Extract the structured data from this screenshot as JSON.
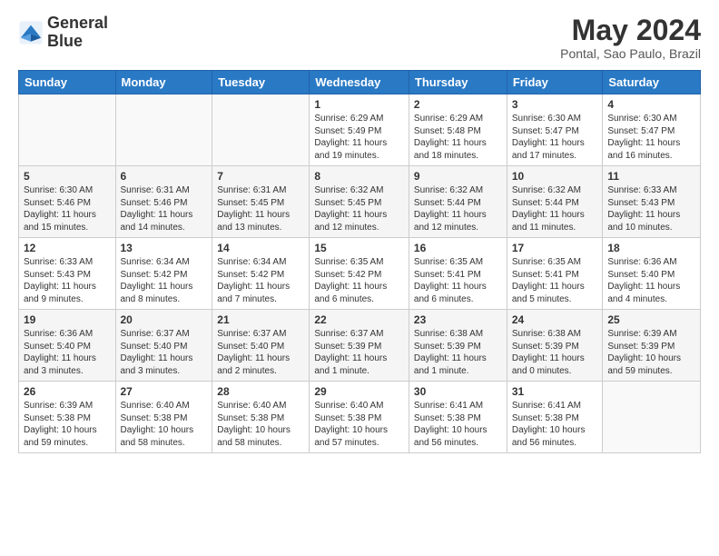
{
  "header": {
    "logo_line1": "General",
    "logo_line2": "Blue",
    "month_title": "May 2024",
    "location": "Pontal, Sao Paulo, Brazil"
  },
  "weekdays": [
    "Sunday",
    "Monday",
    "Tuesday",
    "Wednesday",
    "Thursday",
    "Friday",
    "Saturday"
  ],
  "weeks": [
    [
      {
        "day": "",
        "sunrise": "",
        "sunset": "",
        "daylight": ""
      },
      {
        "day": "",
        "sunrise": "",
        "sunset": "",
        "daylight": ""
      },
      {
        "day": "",
        "sunrise": "",
        "sunset": "",
        "daylight": ""
      },
      {
        "day": "1",
        "sunrise": "Sunrise: 6:29 AM",
        "sunset": "Sunset: 5:49 PM",
        "daylight": "Daylight: 11 hours and 19 minutes."
      },
      {
        "day": "2",
        "sunrise": "Sunrise: 6:29 AM",
        "sunset": "Sunset: 5:48 PM",
        "daylight": "Daylight: 11 hours and 18 minutes."
      },
      {
        "day": "3",
        "sunrise": "Sunrise: 6:30 AM",
        "sunset": "Sunset: 5:47 PM",
        "daylight": "Daylight: 11 hours and 17 minutes."
      },
      {
        "day": "4",
        "sunrise": "Sunrise: 6:30 AM",
        "sunset": "Sunset: 5:47 PM",
        "daylight": "Daylight: 11 hours and 16 minutes."
      }
    ],
    [
      {
        "day": "5",
        "sunrise": "Sunrise: 6:30 AM",
        "sunset": "Sunset: 5:46 PM",
        "daylight": "Daylight: 11 hours and 15 minutes."
      },
      {
        "day": "6",
        "sunrise": "Sunrise: 6:31 AM",
        "sunset": "Sunset: 5:46 PM",
        "daylight": "Daylight: 11 hours and 14 minutes."
      },
      {
        "day": "7",
        "sunrise": "Sunrise: 6:31 AM",
        "sunset": "Sunset: 5:45 PM",
        "daylight": "Daylight: 11 hours and 13 minutes."
      },
      {
        "day": "8",
        "sunrise": "Sunrise: 6:32 AM",
        "sunset": "Sunset: 5:45 PM",
        "daylight": "Daylight: 11 hours and 12 minutes."
      },
      {
        "day": "9",
        "sunrise": "Sunrise: 6:32 AM",
        "sunset": "Sunset: 5:44 PM",
        "daylight": "Daylight: 11 hours and 12 minutes."
      },
      {
        "day": "10",
        "sunrise": "Sunrise: 6:32 AM",
        "sunset": "Sunset: 5:44 PM",
        "daylight": "Daylight: 11 hours and 11 minutes."
      },
      {
        "day": "11",
        "sunrise": "Sunrise: 6:33 AM",
        "sunset": "Sunset: 5:43 PM",
        "daylight": "Daylight: 11 hours and 10 minutes."
      }
    ],
    [
      {
        "day": "12",
        "sunrise": "Sunrise: 6:33 AM",
        "sunset": "Sunset: 5:43 PM",
        "daylight": "Daylight: 11 hours and 9 minutes."
      },
      {
        "day": "13",
        "sunrise": "Sunrise: 6:34 AM",
        "sunset": "Sunset: 5:42 PM",
        "daylight": "Daylight: 11 hours and 8 minutes."
      },
      {
        "day": "14",
        "sunrise": "Sunrise: 6:34 AM",
        "sunset": "Sunset: 5:42 PM",
        "daylight": "Daylight: 11 hours and 7 minutes."
      },
      {
        "day": "15",
        "sunrise": "Sunrise: 6:35 AM",
        "sunset": "Sunset: 5:42 PM",
        "daylight": "Daylight: 11 hours and 6 minutes."
      },
      {
        "day": "16",
        "sunrise": "Sunrise: 6:35 AM",
        "sunset": "Sunset: 5:41 PM",
        "daylight": "Daylight: 11 hours and 6 minutes."
      },
      {
        "day": "17",
        "sunrise": "Sunrise: 6:35 AM",
        "sunset": "Sunset: 5:41 PM",
        "daylight": "Daylight: 11 hours and 5 minutes."
      },
      {
        "day": "18",
        "sunrise": "Sunrise: 6:36 AM",
        "sunset": "Sunset: 5:40 PM",
        "daylight": "Daylight: 11 hours and 4 minutes."
      }
    ],
    [
      {
        "day": "19",
        "sunrise": "Sunrise: 6:36 AM",
        "sunset": "Sunset: 5:40 PM",
        "daylight": "Daylight: 11 hours and 3 minutes."
      },
      {
        "day": "20",
        "sunrise": "Sunrise: 6:37 AM",
        "sunset": "Sunset: 5:40 PM",
        "daylight": "Daylight: 11 hours and 3 minutes."
      },
      {
        "day": "21",
        "sunrise": "Sunrise: 6:37 AM",
        "sunset": "Sunset: 5:40 PM",
        "daylight": "Daylight: 11 hours and 2 minutes."
      },
      {
        "day": "22",
        "sunrise": "Sunrise: 6:37 AM",
        "sunset": "Sunset: 5:39 PM",
        "daylight": "Daylight: 11 hours and 1 minute."
      },
      {
        "day": "23",
        "sunrise": "Sunrise: 6:38 AM",
        "sunset": "Sunset: 5:39 PM",
        "daylight": "Daylight: 11 hours and 1 minute."
      },
      {
        "day": "24",
        "sunrise": "Sunrise: 6:38 AM",
        "sunset": "Sunset: 5:39 PM",
        "daylight": "Daylight: 11 hours and 0 minutes."
      },
      {
        "day": "25",
        "sunrise": "Sunrise: 6:39 AM",
        "sunset": "Sunset: 5:39 PM",
        "daylight": "Daylight: 10 hours and 59 minutes."
      }
    ],
    [
      {
        "day": "26",
        "sunrise": "Sunrise: 6:39 AM",
        "sunset": "Sunset: 5:38 PM",
        "daylight": "Daylight: 10 hours and 59 minutes."
      },
      {
        "day": "27",
        "sunrise": "Sunrise: 6:40 AM",
        "sunset": "Sunset: 5:38 PM",
        "daylight": "Daylight: 10 hours and 58 minutes."
      },
      {
        "day": "28",
        "sunrise": "Sunrise: 6:40 AM",
        "sunset": "Sunset: 5:38 PM",
        "daylight": "Daylight: 10 hours and 58 minutes."
      },
      {
        "day": "29",
        "sunrise": "Sunrise: 6:40 AM",
        "sunset": "Sunset: 5:38 PM",
        "daylight": "Daylight: 10 hours and 57 minutes."
      },
      {
        "day": "30",
        "sunrise": "Sunrise: 6:41 AM",
        "sunset": "Sunset: 5:38 PM",
        "daylight": "Daylight: 10 hours and 56 minutes."
      },
      {
        "day": "31",
        "sunrise": "Sunrise: 6:41 AM",
        "sunset": "Sunset: 5:38 PM",
        "daylight": "Daylight: 10 hours and 56 minutes."
      },
      {
        "day": "",
        "sunrise": "",
        "sunset": "",
        "daylight": ""
      }
    ]
  ]
}
